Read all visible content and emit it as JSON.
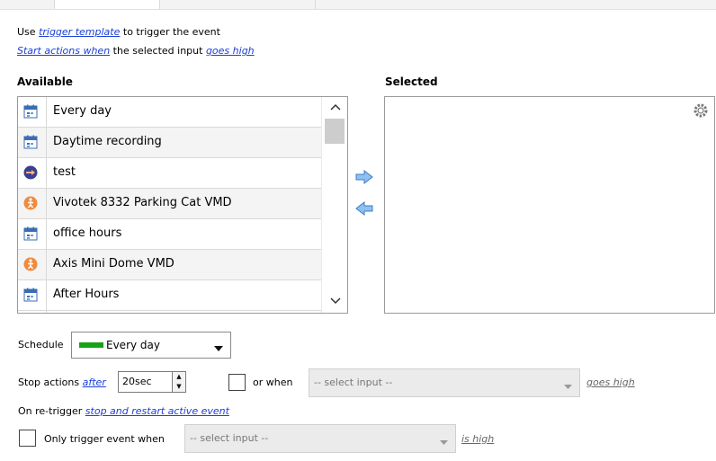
{
  "trigger": {
    "use_prefix": "Use",
    "trigger_template_link": "trigger template",
    "use_suffix": "to trigger the event",
    "start_actions_link": "Start actions when",
    "selected_input_text": "the selected input",
    "goes_high_link": "goes high"
  },
  "available": {
    "header": "Available",
    "items": [
      {
        "label": "Every day",
        "icon": "calendar-icon"
      },
      {
        "label": "Daytime recording",
        "icon": "calendar-icon"
      },
      {
        "label": "test",
        "icon": "pointing-hand-icon"
      },
      {
        "label": "Vivotek 8332 Parking Cat VMD",
        "icon": "motion-person-icon"
      },
      {
        "label": "office hours",
        "icon": "calendar-icon"
      },
      {
        "label": "Axis Mini Dome VMD",
        "icon": "motion-person-icon"
      },
      {
        "label": "After Hours",
        "icon": "calendar-icon"
      }
    ]
  },
  "selected": {
    "header": "Selected"
  },
  "schedule": {
    "label": "Schedule",
    "value": "Every day",
    "swatch_color": "#15a315"
  },
  "stop_actions": {
    "label": "Stop actions",
    "after_link": "after",
    "duration_value": "20sec",
    "or_when_label": "or when",
    "select_input_placeholder": "-- select input --",
    "goes_high_link": "goes high"
  },
  "retrigger": {
    "label": "On re-trigger",
    "link": "stop and restart active event"
  },
  "only_trigger": {
    "label": "Only trigger event when",
    "select_input_placeholder": "-- select input --",
    "is_high_link": "is high"
  },
  "colors": {
    "link": "#1a3fd6",
    "arrow": "#4a8fd8",
    "schedule_swatch": "#15a315"
  }
}
